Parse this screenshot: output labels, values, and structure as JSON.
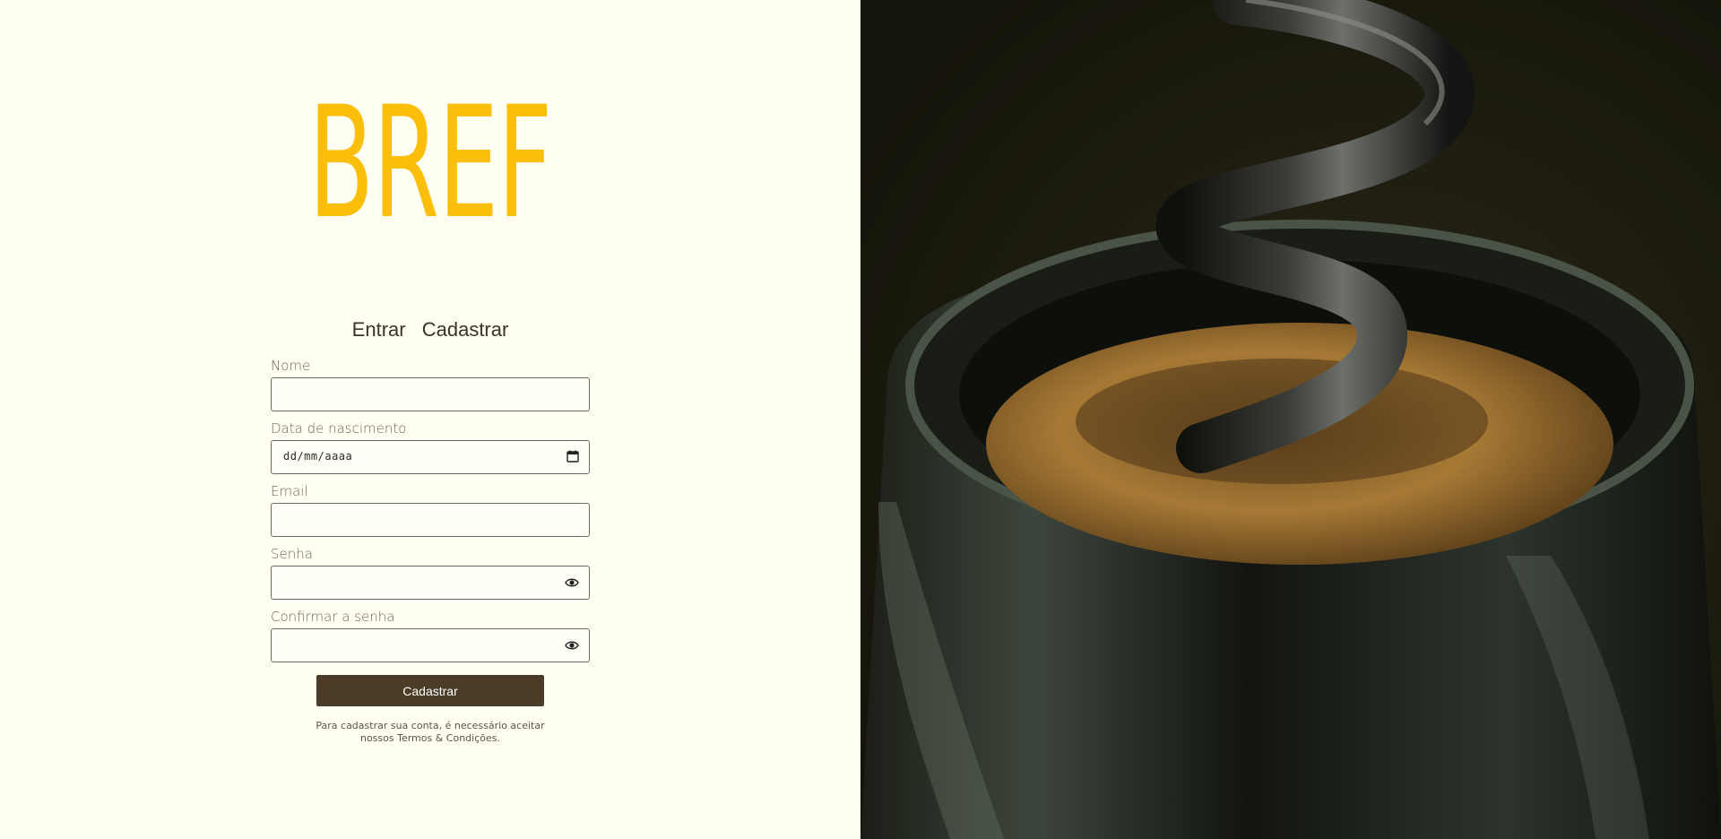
{
  "brand": {
    "logo_text": "BREF",
    "color": "#fbbf0a"
  },
  "tabs": [
    {
      "label": "Entrar"
    },
    {
      "label": "Cadastrar"
    }
  ],
  "form": {
    "fields": {
      "nome": {
        "label": "Nome",
        "value": ""
      },
      "nascimento": {
        "label": "Data de nascimento",
        "value": "",
        "placeholder": "dd/mm/aaaa"
      },
      "email": {
        "label": "Email",
        "value": ""
      },
      "senha": {
        "label": "Senha",
        "value": ""
      },
      "confirmar": {
        "label": "Confirmar a senha",
        "value": ""
      }
    },
    "submit_label": "Cadastrar",
    "terms_line1": "Para cadastrar sua conta, é necessário aceitar",
    "terms_line2": "nossos Termos & Condições."
  },
  "colors": {
    "background": "#fffff3",
    "button": "#4a3c26",
    "text": "#3a3424"
  },
  "icons": {
    "calendar": "calendar-icon",
    "password_toggle": "eye-icon"
  }
}
